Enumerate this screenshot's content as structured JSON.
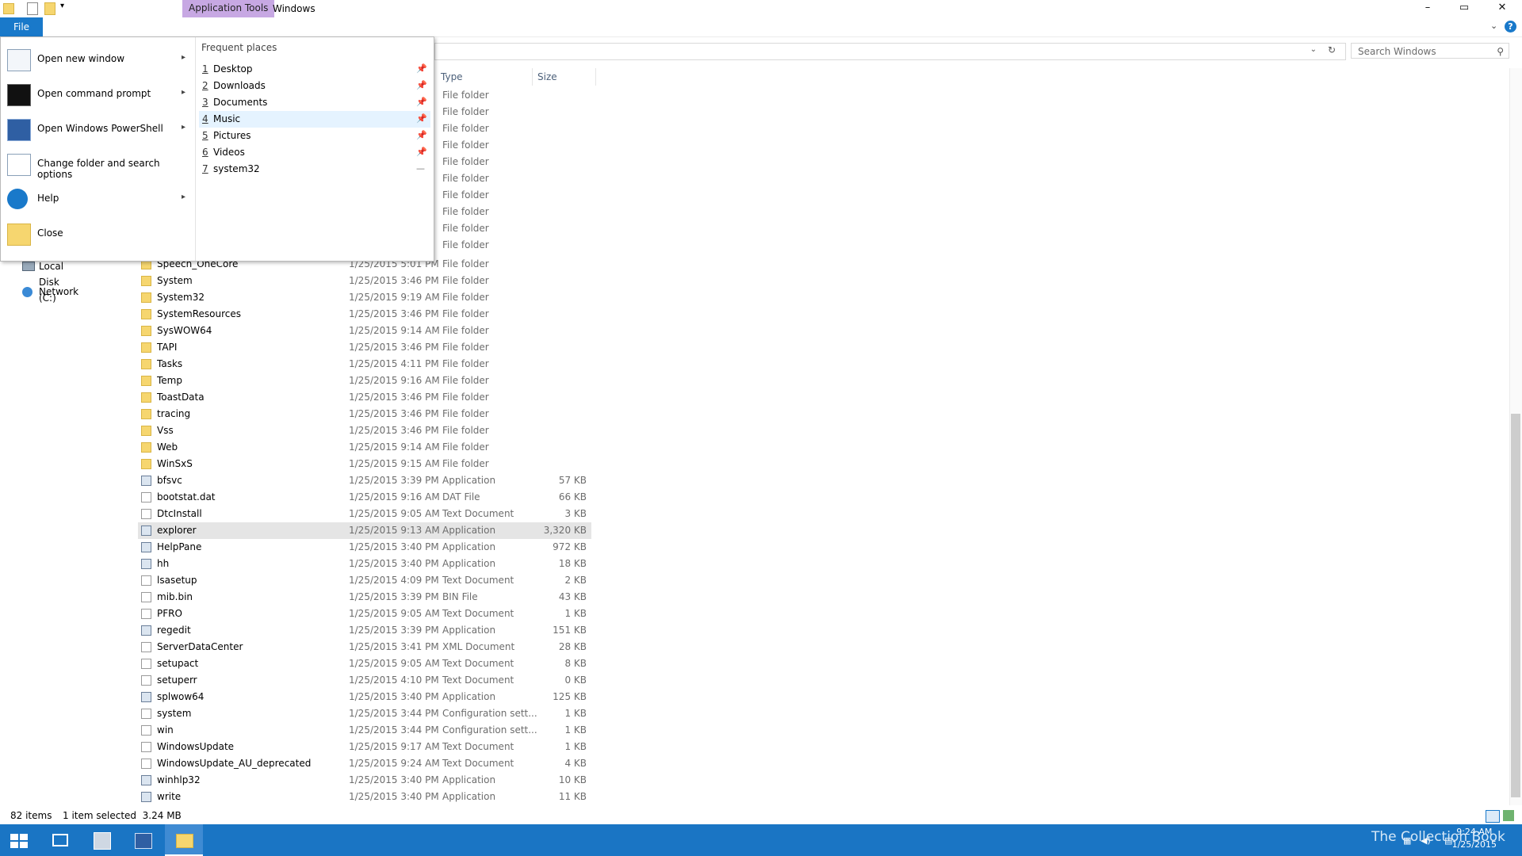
{
  "titlebar": {
    "app_tools": "Application Tools",
    "window_title": "Windows",
    "minimize": "–",
    "maximize": "▭",
    "close": "✕"
  },
  "ribbon": {
    "file_tab": "File"
  },
  "search": {
    "placeholder": "Search Windows"
  },
  "columns": {
    "type": "Type",
    "size": "Size"
  },
  "file_menu": {
    "items": [
      {
        "label": "Open new window",
        "icon": "new-window-icon",
        "has_submenu": true
      },
      {
        "label": "Open command prompt",
        "icon": "command-prompt-icon",
        "has_submenu": true
      },
      {
        "label": "Open Windows PowerShell",
        "icon": "powershell-icon",
        "has_submenu": true
      },
      {
        "label": "Change folder and search options",
        "icon": "folder-options-icon",
        "has_submenu": false
      },
      {
        "label": "Help",
        "icon": "help-icon",
        "has_submenu": true
      },
      {
        "label": "Close",
        "icon": "close-folder-icon",
        "has_submenu": false
      }
    ],
    "frequent_header": "Frequent places",
    "frequent": [
      {
        "num": "1",
        "label": "Desktop",
        "pinned": true
      },
      {
        "num": "2",
        "label": "Downloads",
        "pinned": true
      },
      {
        "num": "3",
        "label": "Documents",
        "pinned": true
      },
      {
        "num": "4",
        "label": "Music",
        "pinned": true
      },
      {
        "num": "5",
        "label": "Pictures",
        "pinned": true
      },
      {
        "num": "6",
        "label": "Videos",
        "pinned": true
      },
      {
        "num": "7",
        "label": "system32",
        "pinned": false
      }
    ]
  },
  "hidden_types": [
    "File folder",
    "File folder",
    "File folder",
    "File folder",
    "File folder",
    "File folder",
    "File folder",
    "File folder",
    "File folder",
    "File folder"
  ],
  "nav": [
    {
      "label": "Local Disk (C:)",
      "icon": "drive-icon"
    },
    {
      "label": "Network",
      "icon": "network-icon"
    }
  ],
  "files": [
    {
      "name": "Speech_OneCore",
      "date": "1/25/2015 5:01 PM",
      "type": "File folder",
      "size": "",
      "kind": "folder"
    },
    {
      "name": "System",
      "date": "1/25/2015 3:46 PM",
      "type": "File folder",
      "size": "",
      "kind": "folder"
    },
    {
      "name": "System32",
      "date": "1/25/2015 9:19 AM",
      "type": "File folder",
      "size": "",
      "kind": "folder"
    },
    {
      "name": "SystemResources",
      "date": "1/25/2015 3:46 PM",
      "type": "File folder",
      "size": "",
      "kind": "folder"
    },
    {
      "name": "SysWOW64",
      "date": "1/25/2015 9:14 AM",
      "type": "File folder",
      "size": "",
      "kind": "folder"
    },
    {
      "name": "TAPI",
      "date": "1/25/2015 3:46 PM",
      "type": "File folder",
      "size": "",
      "kind": "folder"
    },
    {
      "name": "Tasks",
      "date": "1/25/2015 4:11 PM",
      "type": "File folder",
      "size": "",
      "kind": "folder"
    },
    {
      "name": "Temp",
      "date": "1/25/2015 9:16 AM",
      "type": "File folder",
      "size": "",
      "kind": "folder"
    },
    {
      "name": "ToastData",
      "date": "1/25/2015 3:46 PM",
      "type": "File folder",
      "size": "",
      "kind": "folder"
    },
    {
      "name": "tracing",
      "date": "1/25/2015 3:46 PM",
      "type": "File folder",
      "size": "",
      "kind": "folder"
    },
    {
      "name": "Vss",
      "date": "1/25/2015 3:46 PM",
      "type": "File folder",
      "size": "",
      "kind": "folder"
    },
    {
      "name": "Web",
      "date": "1/25/2015 9:14 AM",
      "type": "File folder",
      "size": "",
      "kind": "folder"
    },
    {
      "name": "WinSxS",
      "date": "1/25/2015 9:15 AM",
      "type": "File folder",
      "size": "",
      "kind": "folder"
    },
    {
      "name": "bfsvc",
      "date": "1/25/2015 3:39 PM",
      "type": "Application",
      "size": "57 KB",
      "kind": "app"
    },
    {
      "name": "bootstat.dat",
      "date": "1/25/2015 9:16 AM",
      "type": "DAT File",
      "size": "66 KB",
      "kind": "file"
    },
    {
      "name": "DtcInstall",
      "date": "1/25/2015 9:05 AM",
      "type": "Text Document",
      "size": "3 KB",
      "kind": "file"
    },
    {
      "name": "explorer",
      "date": "1/25/2015 9:13 AM",
      "type": "Application",
      "size": "3,320 KB",
      "kind": "app",
      "selected": true
    },
    {
      "name": "HelpPane",
      "date": "1/25/2015 3:40 PM",
      "type": "Application",
      "size": "972 KB",
      "kind": "app"
    },
    {
      "name": "hh",
      "date": "1/25/2015 3:40 PM",
      "type": "Application",
      "size": "18 KB",
      "kind": "app"
    },
    {
      "name": "lsasetup",
      "date": "1/25/2015 4:09 PM",
      "type": "Text Document",
      "size": "2 KB",
      "kind": "file"
    },
    {
      "name": "mib.bin",
      "date": "1/25/2015 3:39 PM",
      "type": "BIN File",
      "size": "43 KB",
      "kind": "file"
    },
    {
      "name": "PFRO",
      "date": "1/25/2015 9:05 AM",
      "type": "Text Document",
      "size": "1 KB",
      "kind": "file"
    },
    {
      "name": "regedit",
      "date": "1/25/2015 3:39 PM",
      "type": "Application",
      "size": "151 KB",
      "kind": "app"
    },
    {
      "name": "ServerDataCenter",
      "date": "1/25/2015 3:41 PM",
      "type": "XML Document",
      "size": "28 KB",
      "kind": "file"
    },
    {
      "name": "setupact",
      "date": "1/25/2015 9:05 AM",
      "type": "Text Document",
      "size": "8 KB",
      "kind": "file"
    },
    {
      "name": "setuperr",
      "date": "1/25/2015 4:10 PM",
      "type": "Text Document",
      "size": "0 KB",
      "kind": "file"
    },
    {
      "name": "splwow64",
      "date": "1/25/2015 3:40 PM",
      "type": "Application",
      "size": "125 KB",
      "kind": "app"
    },
    {
      "name": "system",
      "date": "1/25/2015 3:44 PM",
      "type": "Configuration sett...",
      "size": "1 KB",
      "kind": "file"
    },
    {
      "name": "win",
      "date": "1/25/2015 3:44 PM",
      "type": "Configuration sett...",
      "size": "1 KB",
      "kind": "file"
    },
    {
      "name": "WindowsUpdate",
      "date": "1/25/2015 9:17 AM",
      "type": "Text Document",
      "size": "1 KB",
      "kind": "file"
    },
    {
      "name": "WindowsUpdate_AU_deprecated",
      "date": "1/25/2015 9:24 AM",
      "type": "Text Document",
      "size": "4 KB",
      "kind": "file"
    },
    {
      "name": "winhlp32",
      "date": "1/25/2015 3:40 PM",
      "type": "Application",
      "size": "10 KB",
      "kind": "app"
    },
    {
      "name": "write",
      "date": "1/25/2015 3:40 PM",
      "type": "Application",
      "size": "11 KB",
      "kind": "app"
    }
  ],
  "status": {
    "items": "82 items",
    "selected": "1 item selected  3.24 MB"
  },
  "taskbar": {
    "time": "9:24 AM",
    "date": "1/25/2015",
    "watermark": "The Collection Book"
  },
  "colors": {
    "accent": "#1979ca",
    "taskbar": "#1a75c4",
    "app_tools_tab": "#c7a8e3"
  }
}
